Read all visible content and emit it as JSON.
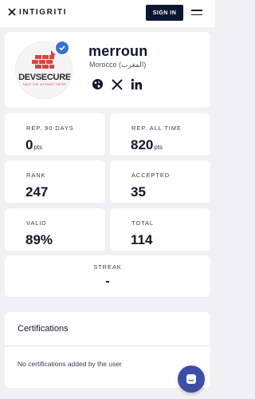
{
  "header": {
    "brand": "INTIGRITI",
    "signin_label": "SIGN IN",
    "logo_icon": "intigriti-logo-icon",
    "menu_icon": "hamburger-icon"
  },
  "profile": {
    "username": "merroun",
    "location": "Morocco (المغرب)",
    "avatar_brand": "DEVSECURE",
    "avatar_tagline": "MAKE THE INTERNET SAFER",
    "verified_icon": "verified-check-icon",
    "socials": [
      "globe-icon",
      "x-icon",
      "linkedin-icon"
    ]
  },
  "stats": [
    {
      "label": "REP. 90 DAYS",
      "value": "0",
      "unit": "pts"
    },
    {
      "label": "REP. ALL TIME",
      "value": "820",
      "unit": "pts"
    },
    {
      "label": "RANK",
      "value": "247",
      "unit": ""
    },
    {
      "label": "ACCEPTED",
      "value": "35",
      "unit": ""
    },
    {
      "label": "VALID",
      "value": "89%",
      "unit": ""
    },
    {
      "label": "TOTAL",
      "value": "114",
      "unit": ""
    }
  ],
  "streak": {
    "label": "STREAK",
    "value": "-"
  },
  "certifications": {
    "title": "Certifications",
    "empty_text": "No certifications added by the user"
  },
  "chat": {
    "icon": "chat-bubble-icon"
  },
  "colors": {
    "background": "#f1f1f3",
    "navy": "#0b1633",
    "verified": "#3a6fd8",
    "chat": "#3d4ea6",
    "brand_red": "#d9453f"
  }
}
